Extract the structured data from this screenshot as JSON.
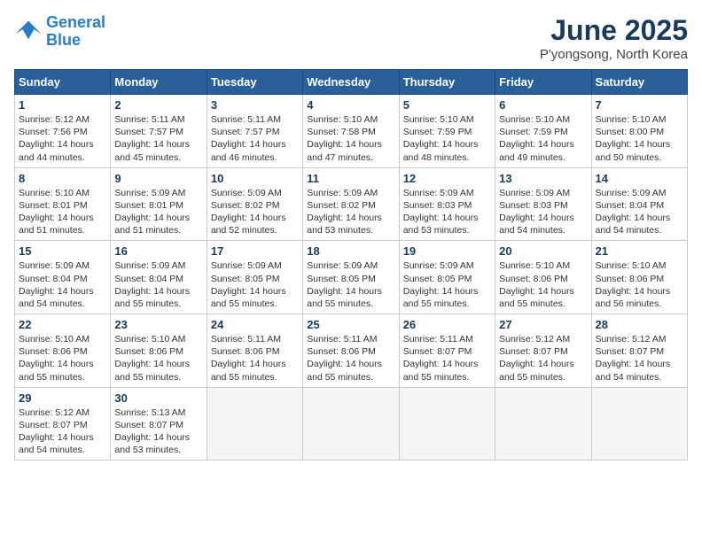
{
  "logo": {
    "line1": "General",
    "line2": "Blue"
  },
  "title": "June 2025",
  "subtitle": "P'yongsong, North Korea",
  "days_header": [
    "Sunday",
    "Monday",
    "Tuesday",
    "Wednesday",
    "Thursday",
    "Friday",
    "Saturday"
  ],
  "weeks": [
    [
      {
        "num": "1",
        "sunrise": "5:12 AM",
        "sunset": "7:56 PM",
        "daylight": "14 hours and 44 minutes."
      },
      {
        "num": "2",
        "sunrise": "5:11 AM",
        "sunset": "7:57 PM",
        "daylight": "14 hours and 45 minutes."
      },
      {
        "num": "3",
        "sunrise": "5:11 AM",
        "sunset": "7:57 PM",
        "daylight": "14 hours and 46 minutes."
      },
      {
        "num": "4",
        "sunrise": "5:10 AM",
        "sunset": "7:58 PM",
        "daylight": "14 hours and 47 minutes."
      },
      {
        "num": "5",
        "sunrise": "5:10 AM",
        "sunset": "7:59 PM",
        "daylight": "14 hours and 48 minutes."
      },
      {
        "num": "6",
        "sunrise": "5:10 AM",
        "sunset": "7:59 PM",
        "daylight": "14 hours and 49 minutes."
      },
      {
        "num": "7",
        "sunrise": "5:10 AM",
        "sunset": "8:00 PM",
        "daylight": "14 hours and 50 minutes."
      }
    ],
    [
      {
        "num": "8",
        "sunrise": "5:10 AM",
        "sunset": "8:01 PM",
        "daylight": "14 hours and 51 minutes."
      },
      {
        "num": "9",
        "sunrise": "5:09 AM",
        "sunset": "8:01 PM",
        "daylight": "14 hours and 51 minutes."
      },
      {
        "num": "10",
        "sunrise": "5:09 AM",
        "sunset": "8:02 PM",
        "daylight": "14 hours and 52 minutes."
      },
      {
        "num": "11",
        "sunrise": "5:09 AM",
        "sunset": "8:02 PM",
        "daylight": "14 hours and 53 minutes."
      },
      {
        "num": "12",
        "sunrise": "5:09 AM",
        "sunset": "8:03 PM",
        "daylight": "14 hours and 53 minutes."
      },
      {
        "num": "13",
        "sunrise": "5:09 AM",
        "sunset": "8:03 PM",
        "daylight": "14 hours and 54 minutes."
      },
      {
        "num": "14",
        "sunrise": "5:09 AM",
        "sunset": "8:04 PM",
        "daylight": "14 hours and 54 minutes."
      }
    ],
    [
      {
        "num": "15",
        "sunrise": "5:09 AM",
        "sunset": "8:04 PM",
        "daylight": "14 hours and 54 minutes."
      },
      {
        "num": "16",
        "sunrise": "5:09 AM",
        "sunset": "8:04 PM",
        "daylight": "14 hours and 55 minutes."
      },
      {
        "num": "17",
        "sunrise": "5:09 AM",
        "sunset": "8:05 PM",
        "daylight": "14 hours and 55 minutes."
      },
      {
        "num": "18",
        "sunrise": "5:09 AM",
        "sunset": "8:05 PM",
        "daylight": "14 hours and 55 minutes."
      },
      {
        "num": "19",
        "sunrise": "5:09 AM",
        "sunset": "8:05 PM",
        "daylight": "14 hours and 55 minutes."
      },
      {
        "num": "20",
        "sunrise": "5:10 AM",
        "sunset": "8:06 PM",
        "daylight": "14 hours and 55 minutes."
      },
      {
        "num": "21",
        "sunrise": "5:10 AM",
        "sunset": "8:06 PM",
        "daylight": "14 hours and 56 minutes."
      }
    ],
    [
      {
        "num": "22",
        "sunrise": "5:10 AM",
        "sunset": "8:06 PM",
        "daylight": "14 hours and 55 minutes."
      },
      {
        "num": "23",
        "sunrise": "5:10 AM",
        "sunset": "8:06 PM",
        "daylight": "14 hours and 55 minutes."
      },
      {
        "num": "24",
        "sunrise": "5:11 AM",
        "sunset": "8:06 PM",
        "daylight": "14 hours and 55 minutes."
      },
      {
        "num": "25",
        "sunrise": "5:11 AM",
        "sunset": "8:06 PM",
        "daylight": "14 hours and 55 minutes."
      },
      {
        "num": "26",
        "sunrise": "5:11 AM",
        "sunset": "8:07 PM",
        "daylight": "14 hours and 55 minutes."
      },
      {
        "num": "27",
        "sunrise": "5:12 AM",
        "sunset": "8:07 PM",
        "daylight": "14 hours and 55 minutes."
      },
      {
        "num": "28",
        "sunrise": "5:12 AM",
        "sunset": "8:07 PM",
        "daylight": "14 hours and 54 minutes."
      }
    ],
    [
      {
        "num": "29",
        "sunrise": "5:12 AM",
        "sunset": "8:07 PM",
        "daylight": "14 hours and 54 minutes."
      },
      {
        "num": "30",
        "sunrise": "5:13 AM",
        "sunset": "8:07 PM",
        "daylight": "14 hours and 53 minutes."
      },
      null,
      null,
      null,
      null,
      null
    ]
  ]
}
